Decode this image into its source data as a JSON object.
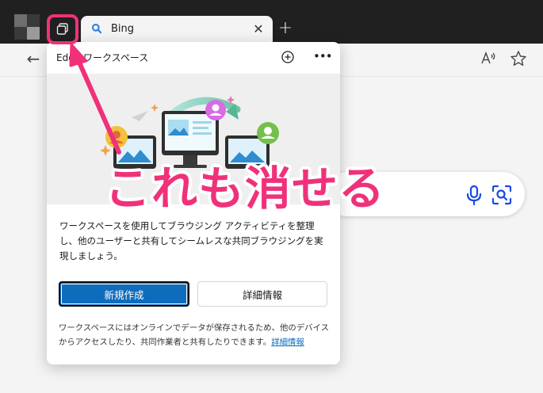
{
  "browser": {
    "tab": {
      "title": "Bing",
      "close_glyph": "✕"
    },
    "new_tab_glyph": "+",
    "back_glyph": "←",
    "icons": [
      "workspaces-icon",
      "search-icon",
      "read-aloud-icon",
      "favorite-star-icon",
      "microphone-icon",
      "visual-search-icon"
    ]
  },
  "workspaces_flyout": {
    "title": "Edge ワークスペース",
    "add_glyph": "+",
    "more_glyph": "•••",
    "description": "ワークスペースを使用してブラウジング アクティビティを整理し、他のユーザーと共有してシームレスな共同ブラウジングを実現しましょう。",
    "new_button": "新規作成",
    "details_button": "詳細情報",
    "note_text": "ワークスペースにはオンラインでデータが保存されるため、他のデバイスからアクセスしたり、共同作業者と共有したりできます。",
    "note_link": "詳細情報"
  },
  "annotation": {
    "caption": "これも消せる",
    "color": "#f0317a"
  },
  "colors": {
    "tabstrip": "#202020",
    "accent_blue": "#0f6cbd",
    "annotation_pink": "#f0317a"
  }
}
